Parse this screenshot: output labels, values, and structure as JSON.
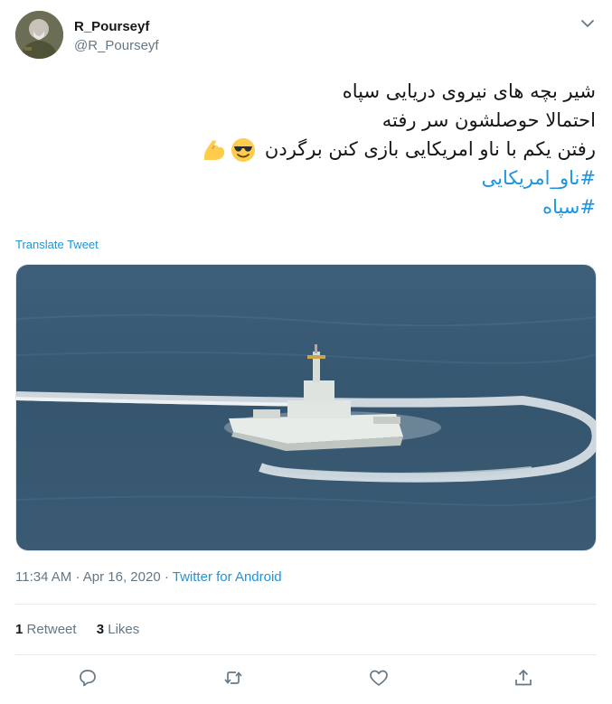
{
  "user": {
    "display_name": "R_Pourseyf",
    "handle": "@R_Pourseyf"
  },
  "tweet": {
    "lines": [
      "شیر بچه های نیروی دریایی سپاه",
      "احتمالا حوصلشون سر رفته",
      "رفتن یکم با ناو امریکایی بازی کنن برگردن"
    ],
    "emojis": [
      "sunglasses-face-icon",
      "flexed-biceps-icon"
    ],
    "hashtags": [
      "#ناو_امریکایی",
      "#سپاه"
    ]
  },
  "translate_label": "Translate Tweet",
  "media": {
    "description_icon": "boat-photo"
  },
  "meta": {
    "time": "11:34 AM",
    "date": "Apr 16, 2020",
    "separator": "·",
    "source": "Twitter for Android"
  },
  "stats": {
    "retweets_count": "1",
    "retweets_label": "Retweet",
    "likes_count": "3",
    "likes_label": "Likes"
  },
  "colors": {
    "link": "#1b95e0",
    "secondary": "#657786",
    "icon": "#657786"
  },
  "actions": [
    "reply-icon",
    "retweet-icon",
    "like-icon",
    "share-icon"
  ]
}
